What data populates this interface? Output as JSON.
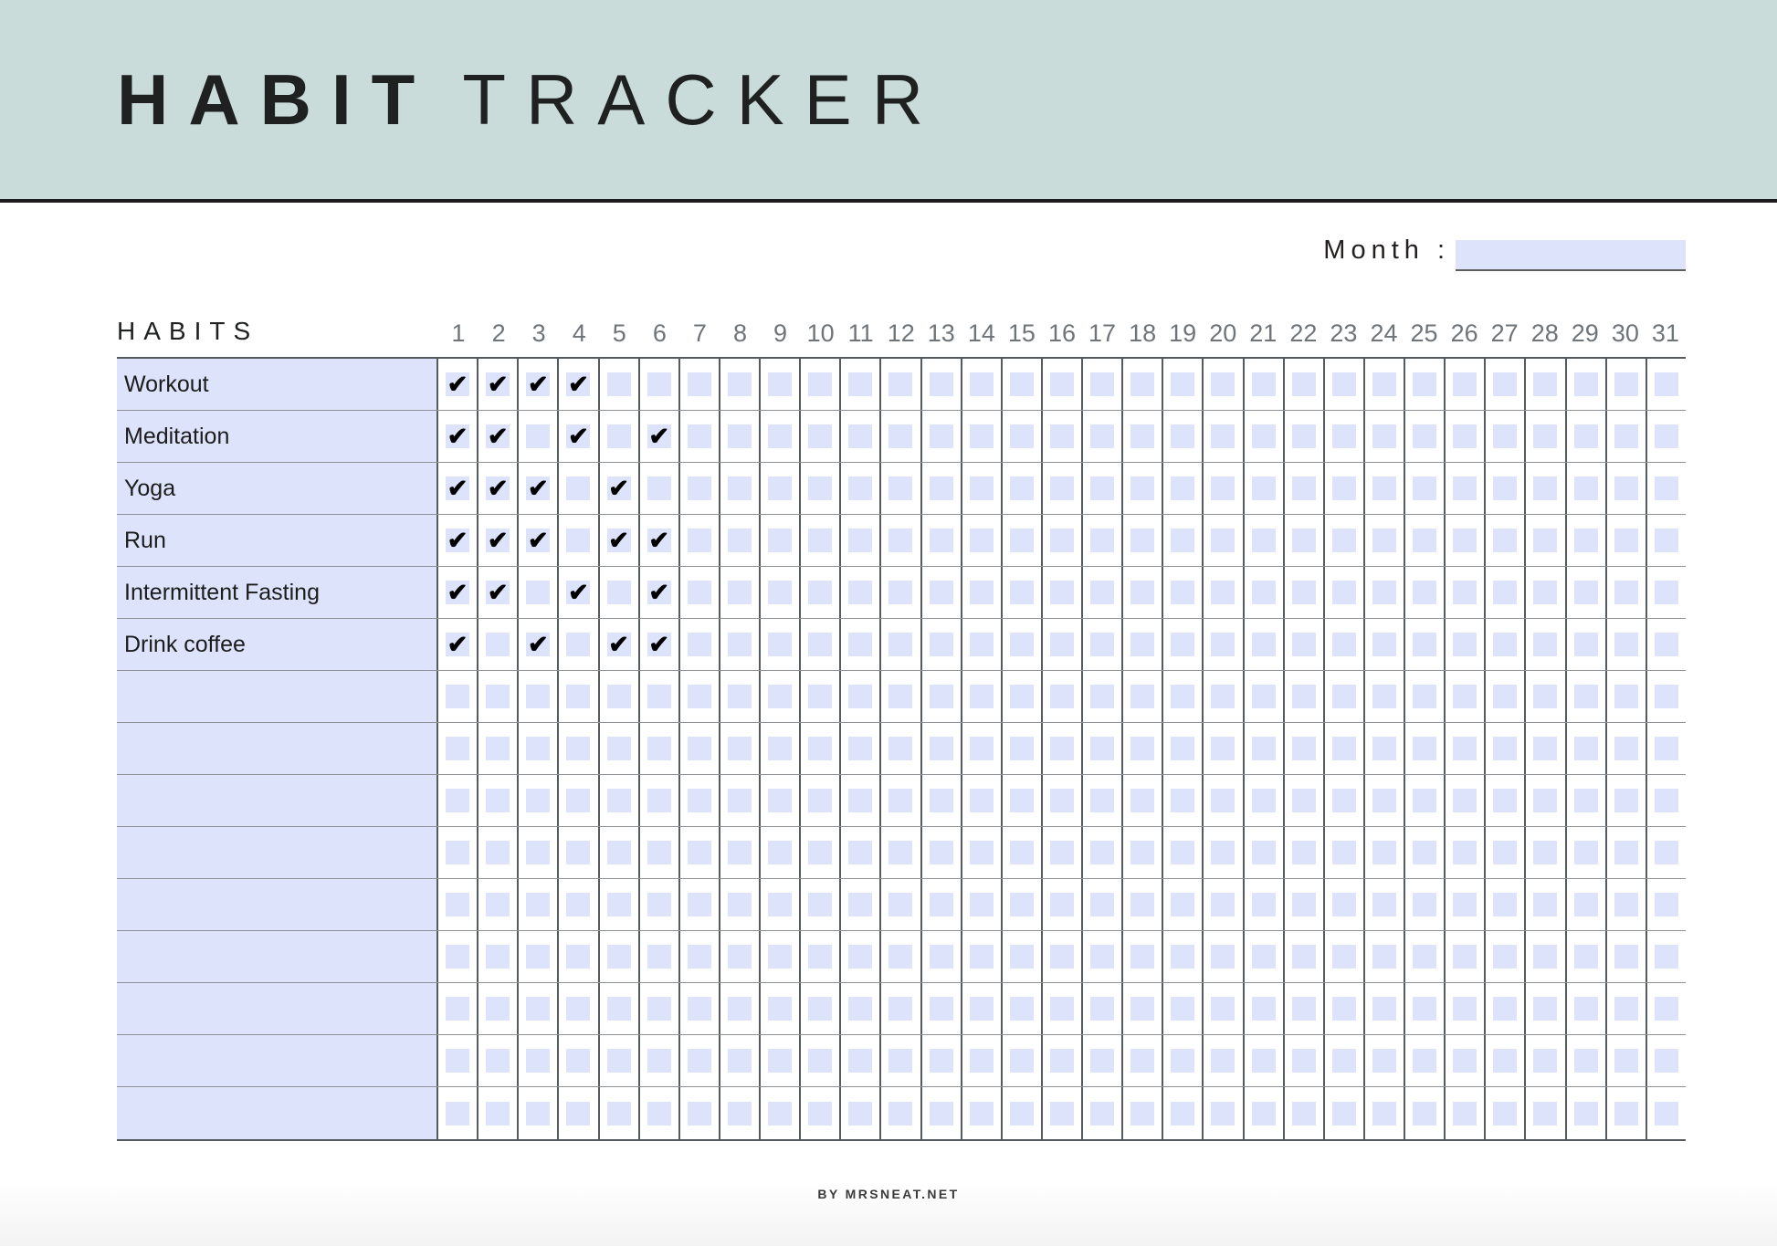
{
  "header": {
    "title_bold": "HABIT",
    "title_light": "TRACKER",
    "background_color": "#c9dcd9"
  },
  "month": {
    "label": "Month :",
    "value": "",
    "placeholder": ""
  },
  "table": {
    "habits_heading": "HABITS",
    "days": [
      1,
      2,
      3,
      4,
      5,
      6,
      7,
      8,
      9,
      10,
      11,
      12,
      13,
      14,
      15,
      16,
      17,
      18,
      19,
      20,
      21,
      22,
      23,
      24,
      25,
      26,
      27,
      28,
      29,
      30,
      31
    ],
    "accent_color": "#dde3fb",
    "check_glyph": "✔",
    "rows": [
      {
        "label": "Workout",
        "checked_days": [
          1,
          2,
          3,
          4
        ]
      },
      {
        "label": "Meditation",
        "checked_days": [
          1,
          2,
          4,
          6
        ]
      },
      {
        "label": "Yoga",
        "checked_days": [
          1,
          2,
          3,
          5
        ]
      },
      {
        "label": "Run",
        "checked_days": [
          1,
          2,
          3,
          5,
          6
        ]
      },
      {
        "label": "Intermittent Fasting",
        "checked_days": [
          1,
          2,
          4,
          6
        ]
      },
      {
        "label": "Drink coffee",
        "checked_days": [
          1,
          3,
          5,
          6
        ]
      },
      {
        "label": "",
        "checked_days": []
      },
      {
        "label": "",
        "checked_days": []
      },
      {
        "label": "",
        "checked_days": []
      },
      {
        "label": "",
        "checked_days": []
      },
      {
        "label": "",
        "checked_days": []
      },
      {
        "label": "",
        "checked_days": []
      },
      {
        "label": "",
        "checked_days": []
      },
      {
        "label": "",
        "checked_days": []
      },
      {
        "label": "",
        "checked_days": []
      }
    ]
  },
  "footer": {
    "credit": "BY MRSNEAT.NET"
  }
}
